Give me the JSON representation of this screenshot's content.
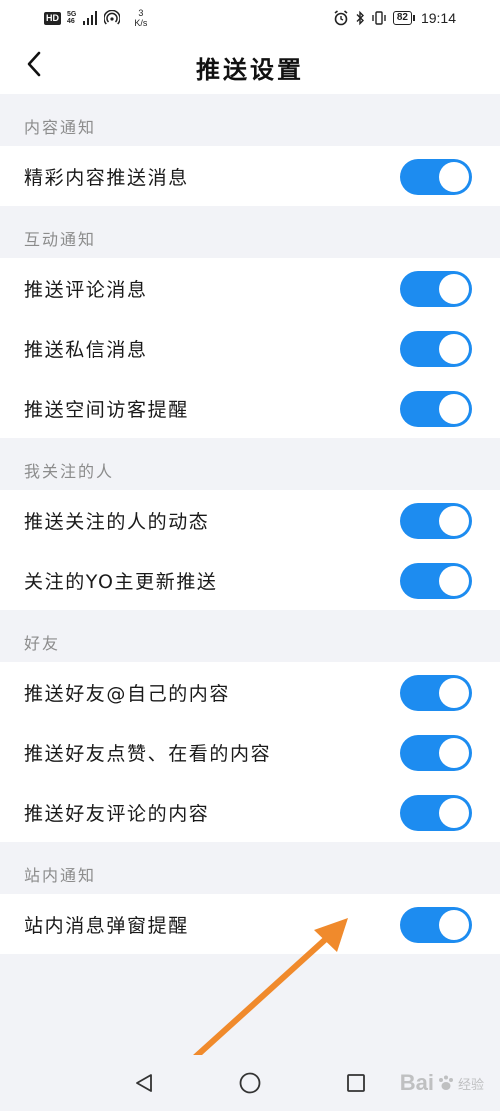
{
  "status_bar": {
    "hd": "HD",
    "network_top": "5G",
    "network_bottom": "46",
    "speed_value": "3",
    "speed_unit": "K/s",
    "battery": "82",
    "time": "19:14"
  },
  "header": {
    "title": "推送设置"
  },
  "sections": [
    {
      "title": "内容通知",
      "items": [
        {
          "label": "精彩内容推送消息",
          "on": true
        }
      ]
    },
    {
      "title": "互动通知",
      "items": [
        {
          "label": "推送评论消息",
          "on": true
        },
        {
          "label": "推送私信消息",
          "on": true
        },
        {
          "label": "推送空间访客提醒",
          "on": true
        }
      ]
    },
    {
      "title": "我关注的人",
      "items": [
        {
          "label": "推送关注的人的动态",
          "on": true
        },
        {
          "label": "关注的YO主更新推送",
          "on": true
        }
      ]
    },
    {
      "title": "好友",
      "items": [
        {
          "label": "推送好友@自己的内容",
          "on": true
        },
        {
          "label": "推送好友点赞、在看的内容",
          "on": true
        },
        {
          "label": "推送好友评论的内容",
          "on": true
        }
      ]
    },
    {
      "title": "站内通知",
      "items": [
        {
          "label": "站内消息弹窗提醒",
          "on": true
        }
      ]
    }
  ],
  "colors": {
    "toggle_on": "#1d8cf0",
    "background": "#f2f3f7",
    "arrow": "#f08a2c"
  },
  "watermark": {
    "brand": "Bai",
    "suffix": "经验"
  }
}
